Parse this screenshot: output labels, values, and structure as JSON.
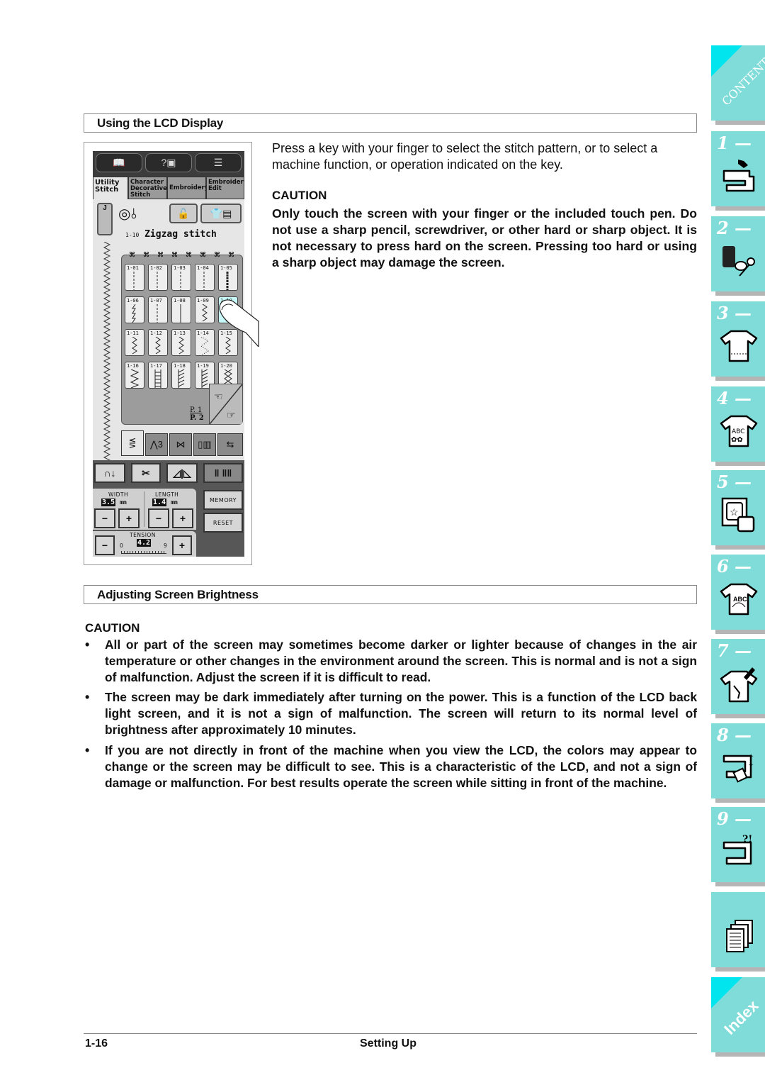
{
  "section1": {
    "heading": "Using the LCD Display",
    "intro": "Press a key with your finger to select the stitch pattern, or to select a machine function, or operation indicated on the key.",
    "caution_label": "CAUTION",
    "caution_text": "Only touch the screen with your finger or the included touch pen. Do not use a sharp pencil, screwdriver, or other hard or sharp object. It is not necessary to press hard on the screen. Pressing too hard or using a sharp object may damage the screen."
  },
  "lcd": {
    "tabs": [
      {
        "label": "Utility Stitch",
        "active": true
      },
      {
        "label": "Character Decorative Stitch",
        "active": false
      },
      {
        "label": "Embroidery",
        "active": false
      },
      {
        "label": "Embroidery Edit",
        "active": false
      }
    ],
    "foot_label": "J",
    "stitch_code": "1-10",
    "stitch_name": "Zigzag stitch",
    "stitch_keys": [
      "1-01",
      "1-02",
      "1-03",
      "1-04",
      "1-05",
      "1-06",
      "1-07",
      "1-08",
      "1-09",
      "1-10",
      "1-11",
      "1-12",
      "1-13",
      "1-14",
      "1-15",
      "1-16",
      "1-17",
      "1-18",
      "1-19",
      "1-20"
    ],
    "selected_key": "1-10",
    "page_current": "P. 1",
    "page_total": "P. 2",
    "width_label": "WIDTH",
    "width_value": "3.5",
    "length_label": "LENGTH",
    "length_value": "1.4",
    "unit": "mm",
    "tension_label": "TENSION",
    "tension_value": "4.2",
    "tension_min": "0",
    "tension_max": "9",
    "memory_label": "MEMORY",
    "reset_label": "RESET",
    "minus": "−",
    "plus": "+"
  },
  "section2": {
    "heading": "Adjusting Screen Brightness",
    "caution_label": "CAUTION",
    "bullets": [
      "All or part of the screen may sometimes become darker or lighter because of changes in the air temperature or other changes in the environment around the screen. This is normal and is not a sign of malfunction. Adjust the screen if it is difficult to read.",
      "The screen may be dark immediately after turning on the power. This is a function of the LCD back light screen, and it is not a sign of malfunction. The screen will return to its normal level of brightness after approximately 10 minutes.",
      "If you are not directly in front of the machine when you view the LCD, the colors may appear to change or the screen may be difficult to see. This is a characteristic of the LCD, and not a sign of damage or malfunction. For best results operate the screen while sitting in front of the machine."
    ]
  },
  "side_tabs": [
    {
      "label": "CONTENTS",
      "icon": "contents"
    },
    {
      "label": "1 —",
      "icon": "sewing-machine-hand-icon"
    },
    {
      "label": "2 —",
      "icon": "thread-spool-scissors-icon"
    },
    {
      "label": "3 —",
      "icon": "shirt-stitch-icon"
    },
    {
      "label": "4 —",
      "icon": "shirt-abc-embroidery-icon"
    },
    {
      "label": "5 —",
      "icon": "embroidery-frame-icon"
    },
    {
      "label": "6 —",
      "icon": "shirt-abc-arc-icon"
    },
    {
      "label": "7 —",
      "icon": "shirt-edit-pencil-icon"
    },
    {
      "label": "8 —",
      "icon": "sewing-machine-maintenance-icon"
    },
    {
      "label": "9 —",
      "icon": "sewing-machine-troubleshoot-icon"
    },
    {
      "label": "",
      "icon": "documents-icon"
    },
    {
      "label": "Index",
      "icon": "index"
    }
  ],
  "footer": {
    "page_number": "1-16",
    "chapter": "Setting Up"
  },
  "colors": {
    "tab_bg": "#7fdcd8",
    "tab_corner": "#00e5ee",
    "selected_key": "#c8f8f8"
  }
}
